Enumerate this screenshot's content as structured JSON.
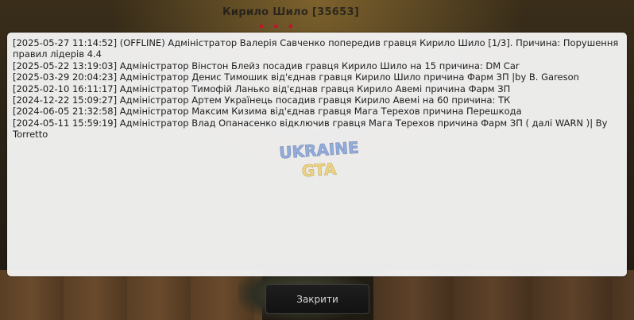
{
  "background": {
    "caption": "Кирило Шило [35653]",
    "dots": "• • •"
  },
  "log": {
    "lines": [
      "[2025-05-27 11:14:52] (OFFLINE) Адміністратор Валерія Савченко попередив гравця Кирило Шило [1/3]. Причина: Порушення правил лідерів 4.4",
      "[2025-05-22 13:19:03] Адміністратор Вінстон Блейз посадив гравця Кирило Шило на 15 причина: DM Car",
      "[2025-03-29 20:04:23] Адміністратор Денис Тимошик від'єднав гравця Кирило Шило причина Фарм ЗП |by B. Gareson",
      "[2025-02-10 16:11:17] Адміністратор Тимофій Ланько від'єднав гравця Кирило Авемі причина Фарм ЗП",
      "[2024-12-22 15:09:27] Адміністратор Артем Українець посадив гравця Кирило Авемі на 60 причина: ТК",
      "[2024-06-05 21:32:58] Адміністратор Максим Кизима від'єднав гравця Мага Терехов причина Перешкода",
      "[2024-05-11 15:59:19] Адміністратор Влад Опанасенко відключив гравця Мага Терехов причина Фарм ЗП ( далі WARN )| By Torretto"
    ]
  },
  "watermark": {
    "line1": "UKRAINE",
    "line2": "GTA"
  },
  "buttons": {
    "close_label": "Закрити"
  },
  "colors": {
    "panel_bg": "#f2f2f2",
    "button_bg": "#151515",
    "text": "#1e1e1e",
    "watermark_blue": "#4a7bd4",
    "watermark_yellow": "#f2c230"
  }
}
